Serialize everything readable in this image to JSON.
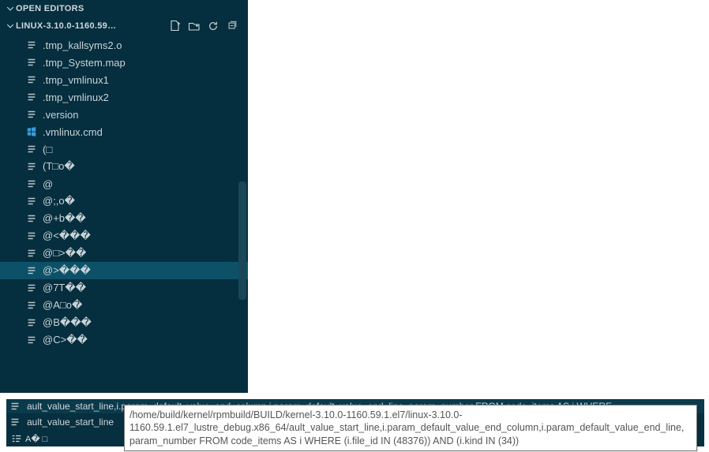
{
  "sidebar": {
    "open_editors_label": "OPEN EDITORS",
    "workspace_label": "LINUX-3.10.0-1160.59.1....",
    "items": [
      {
        "name": ".tmp_kallsyms2.o",
        "icon": "lines",
        "selected": false
      },
      {
        "name": ".tmp_System.map",
        "icon": "lines",
        "selected": false
      },
      {
        "name": ".tmp_vmlinux1",
        "icon": "lines",
        "selected": false
      },
      {
        "name": ".tmp_vmlinux2",
        "icon": "lines",
        "selected": false
      },
      {
        "name": ".version",
        "icon": "lines",
        "selected": false
      },
      {
        "name": ".vmlinux.cmd",
        "icon": "windows",
        "selected": false
      },
      {
        "name": "(□",
        "icon": "lines",
        "selected": false
      },
      {
        "name": "(T□o�",
        "icon": "lines",
        "selected": false
      },
      {
        "name": "@",
        "icon": "lines",
        "selected": false
      },
      {
        "name": "@;,o�",
        "icon": "lines",
        "selected": false
      },
      {
        "name": "@+b��",
        "icon": "lines",
        "selected": false
      },
      {
        "name": "@<���",
        "icon": "lines",
        "selected": false
      },
      {
        "name": "@□>��",
        "icon": "lines",
        "selected": false
      },
      {
        "name": "@>���",
        "icon": "lines",
        "selected": true
      },
      {
        "name": "@7T��",
        "icon": "lines",
        "selected": false
      },
      {
        "name": "@A□o�",
        "icon": "lines",
        "selected": false
      },
      {
        "name": "@B���",
        "icon": "lines",
        "selected": false
      },
      {
        "name": "@C>��",
        "icon": "lines",
        "selected": false
      }
    ]
  },
  "bottom": {
    "row1_label": "ault_value_start_line,i.param_default_value_end_column,i.param_default_value_end_line, param_number FROM code_items AS i WHERE ...",
    "row2_label": "ault_value_start_line",
    "outline_label": "A� □"
  },
  "tooltip": {
    "text": "/home/build/kernel/rpmbuild/BUILD/kernel-3.10.0-1160.59.1.el7/linux-3.10.0-1160.59.1.el7_lustre_debug.x86_64/ault_value_start_line,i.param_default_value_end_column,i.param_default_value_end_line, param_number FROM code_items AS i WHERE (i.file_id  IN (48376)) AND (i.kind  IN (34))"
  }
}
